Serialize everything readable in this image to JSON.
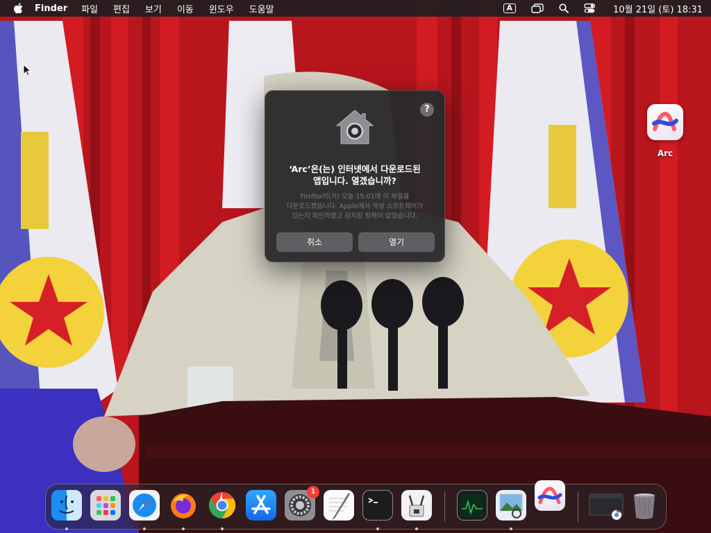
{
  "menubar": {
    "app_name": "Finder",
    "menus": [
      "파일",
      "편집",
      "보기",
      "이동",
      "윈도우",
      "도움말"
    ],
    "input_source": "A",
    "clock": "10월 21일 (토) 18:31"
  },
  "desktop": {
    "icons": [
      {
        "label": "Arc",
        "icon": "arc-app-icon"
      }
    ]
  },
  "dialog": {
    "help": "?",
    "title_line1": "‘Arc’은(는) 인터넷에서 다운로드된",
    "title_line2": "앱입니다. 열겠습니까?",
    "body_line1": "Firefox이(가) 오늘 15:01에 이 파일을",
    "body_line2": "다운로드했습니다. Apple에서 악성 소프트웨어가",
    "body_line3": "있는지 확인하였고 감지된 항목이 없었습니다.",
    "cancel_label": "취소",
    "open_label": "열기"
  },
  "dock": {
    "items": [
      {
        "name": "finder",
        "running": true
      },
      {
        "name": "launchpad",
        "running": false
      },
      {
        "name": "safari",
        "running": true
      },
      {
        "name": "firefox",
        "running": true
      },
      {
        "name": "chrome",
        "running": true
      },
      {
        "name": "app-store",
        "running": false
      },
      {
        "name": "system-settings",
        "running": false,
        "badge": "1"
      },
      {
        "name": "textedit",
        "running": false
      },
      {
        "name": "terminal",
        "running": true
      },
      {
        "name": "archive-utility",
        "running": true
      },
      {
        "name": "activity-monitor",
        "running": false
      },
      {
        "name": "preview",
        "running": true
      },
      {
        "name": "arc",
        "running": false
      },
      {
        "name": "chrome-window-minimized",
        "running": false
      },
      {
        "name": "trash",
        "running": false
      }
    ]
  },
  "colors": {
    "dialog_bg": "#2a2a2c",
    "button_bg": "#5e5e62",
    "badge_red": "#ff3b30"
  }
}
